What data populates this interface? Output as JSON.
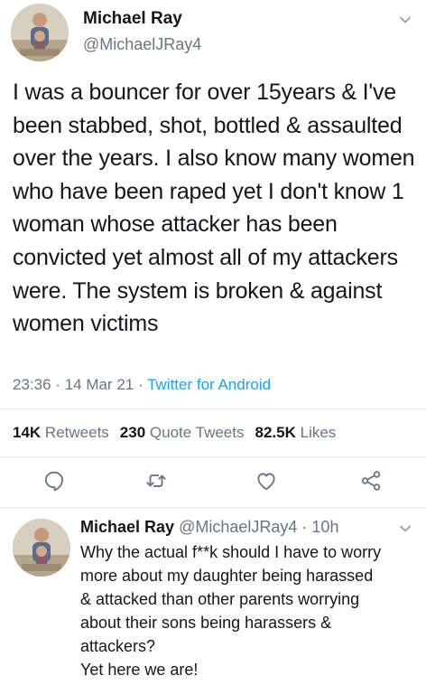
{
  "tweet": {
    "name": "Michael Ray",
    "handle": "@MichaelJRay4",
    "text": "I was a bouncer for over 15years & I've been stabbed, shot, bottled & assaulted over the years. I also know many women who have been raped yet I don't know 1 woman whose attacker has been convicted yet almost all of my attackers were. The system is broken & against women victims",
    "time": "23:36",
    "date": "14 Mar 21",
    "source": "Twitter for Android",
    "separator": "·",
    "retweets_count": "14K",
    "retweets_label": "Retweets",
    "quotes_count": "230",
    "quotes_label": "Quote Tweets",
    "likes_count": "82.5K",
    "likes_label": "Likes"
  },
  "reply": {
    "name": "Michael Ray",
    "handle": "@MichaelJRay4",
    "separator": "·",
    "age": "10h",
    "lines": [
      "Why the actual f**k should I have to worry",
      "more about my daughter being harassed",
      "& attacked than other parents worrying",
      "about their sons being harassers &",
      "attackers?",
      "Yet here we are!"
    ]
  },
  "icons": {
    "chevron": "chevron-down-icon",
    "reply": "reply-icon",
    "retweet": "retweet-icon",
    "like": "heart-icon",
    "share": "share-icon"
  },
  "colors": {
    "text": "#14171a",
    "muted": "#657786",
    "link": "#1da1f2",
    "divider": "#e1e8ed"
  }
}
